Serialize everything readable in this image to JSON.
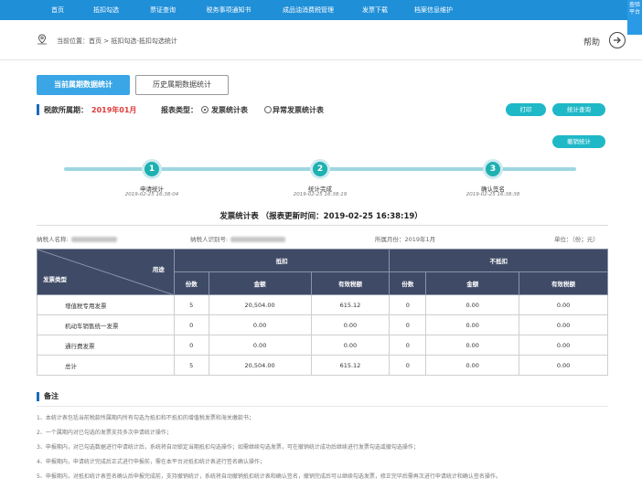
{
  "nav": {
    "items": [
      "首页",
      "抵扣勾选",
      "票证查询",
      "税务事项通知书",
      "成品油消费税管理",
      "发票下载",
      "档案信息维护"
    ],
    "side_badge": "查验平台"
  },
  "breadcrumb": {
    "label": "当前位置：首页 > 抵扣勾选-抵扣勾选统计",
    "help": "帮助"
  },
  "tabs": {
    "current": "当前属期数据统计",
    "history": "历史属期数据统计"
  },
  "filter": {
    "period_label": "税款所属期：",
    "period_value": "2019年01月",
    "type_label": "报表类型：",
    "option_invoice": "发票统计表",
    "option_abnormal": "异常发票统计表",
    "selected": "发票统计表"
  },
  "buttons": {
    "print": "打印",
    "query": "统计查询",
    "cancel": "撤销统计"
  },
  "steps": [
    {
      "num": "1",
      "title": "申请统计",
      "time": "2019-02-25 16:38:04"
    },
    {
      "num": "2",
      "title": "统计完成",
      "time": "2019-02-25 16:38:19"
    },
    {
      "num": "3",
      "title": "确认签名",
      "time": "2019-02-25 16:38:38"
    }
  ],
  "table_title": "发票统计表 （报表更新时间：2019-02-25 16:38:19）",
  "info": {
    "taxpayer_name_label": "纳税人名称:",
    "taxpayer_id_label": "纳税人识别号:",
    "month_label": "所属月份：2019年1月",
    "unit_label": "单位：（份；元）"
  },
  "table": {
    "corner_left": "发票类型",
    "corner_right": "用途",
    "group_deduct": "抵扣",
    "group_nondeduct": "不抵扣",
    "subheaders": [
      "份数",
      "金额",
      "有效税额",
      "份数",
      "金额",
      "有效税额"
    ],
    "rows": [
      {
        "type": "增值税专用发票",
        "values": [
          "5",
          "20,504.00",
          "615.12",
          "0",
          "0.00",
          "0.00"
        ]
      },
      {
        "type": "机动车销售统一发票",
        "values": [
          "0",
          "0.00",
          "0.00",
          "0",
          "0.00",
          "0.00"
        ]
      },
      {
        "type": "通行费发票",
        "values": [
          "0",
          "0.00",
          "0.00",
          "0",
          "0.00",
          "0.00"
        ]
      },
      {
        "type": "总计",
        "values": [
          "5",
          "20,504.00",
          "615.12",
          "0",
          "0.00",
          "0.00"
        ]
      }
    ]
  },
  "notes": {
    "title": "备注",
    "items": [
      "1、本统计表包括当前税款所属期内所有勾选为抵扣和不抵扣的增值税发票和海关缴款书；",
      "2、一个属期内对已勾选的发票支持多次申请统计操作；",
      "3、申报期内，对已勾选数据进行申请统计后，系统将自动锁定当期抵扣勾选操作；如需继续勾选发票，可在撤销统计成功后继续进行发票勾选或撤勾选操作；",
      "4、申报期内，申请统计完成后正式进行申报前，需在本平台对抵扣统计表进行签名确认操作；",
      "5、申报期内，对抵扣统计表签名确认后申报完成前，支持撤销统计，系统将自动撤销抵扣统计表和确认签名，撤销完成后可以继续勾选发票，修正完毕后需再次进行申请统计和确认签名操作。"
    ]
  },
  "colors": {
    "nav_bg": "#1f8fd8",
    "accent": "#1fb8c7",
    "header_bg": "#3f4a66",
    "period": "#e03a3a"
  }
}
